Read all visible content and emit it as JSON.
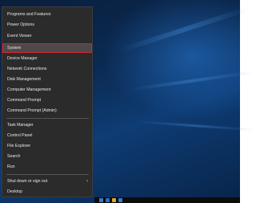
{
  "menu": {
    "items": [
      {
        "label": "Programs and Features",
        "name": "menu-item-programs-and-features"
      },
      {
        "label": "Power Options",
        "name": "menu-item-power-options"
      },
      {
        "label": "Event Viewer",
        "name": "menu-item-event-viewer"
      },
      {
        "label": "System",
        "name": "menu-item-system",
        "selected": true
      },
      {
        "label": "Device Manager",
        "name": "menu-item-device-manager"
      },
      {
        "label": "Network Connections",
        "name": "menu-item-network-connections"
      },
      {
        "label": "Disk Management",
        "name": "menu-item-disk-management"
      },
      {
        "label": "Computer Management",
        "name": "menu-item-computer-management"
      },
      {
        "label": "Command Prompt",
        "name": "menu-item-command-prompt"
      },
      {
        "label": "Command Prompt (Admin)",
        "name": "menu-item-command-prompt-admin"
      },
      {
        "label": "Task Manager",
        "name": "menu-item-task-manager"
      },
      {
        "label": "Control Panel",
        "name": "menu-item-control-panel"
      },
      {
        "label": "File Explorer",
        "name": "menu-item-file-explorer"
      },
      {
        "label": "Search",
        "name": "menu-item-search"
      },
      {
        "label": "Run",
        "name": "menu-item-run"
      },
      {
        "label": "Shut down or sign out",
        "name": "menu-item-shut-down-or-sign-out",
        "submenu": true
      },
      {
        "label": "Desktop",
        "name": "menu-item-desktop"
      }
    ]
  },
  "colors": {
    "menu_background": "#2b2b2b",
    "selected_background": "#4a4a4a",
    "highlight_border": "#e0202a",
    "text": "#e8e8e8"
  },
  "icons": {
    "submenu_indicator": "chevron-right-icon"
  }
}
